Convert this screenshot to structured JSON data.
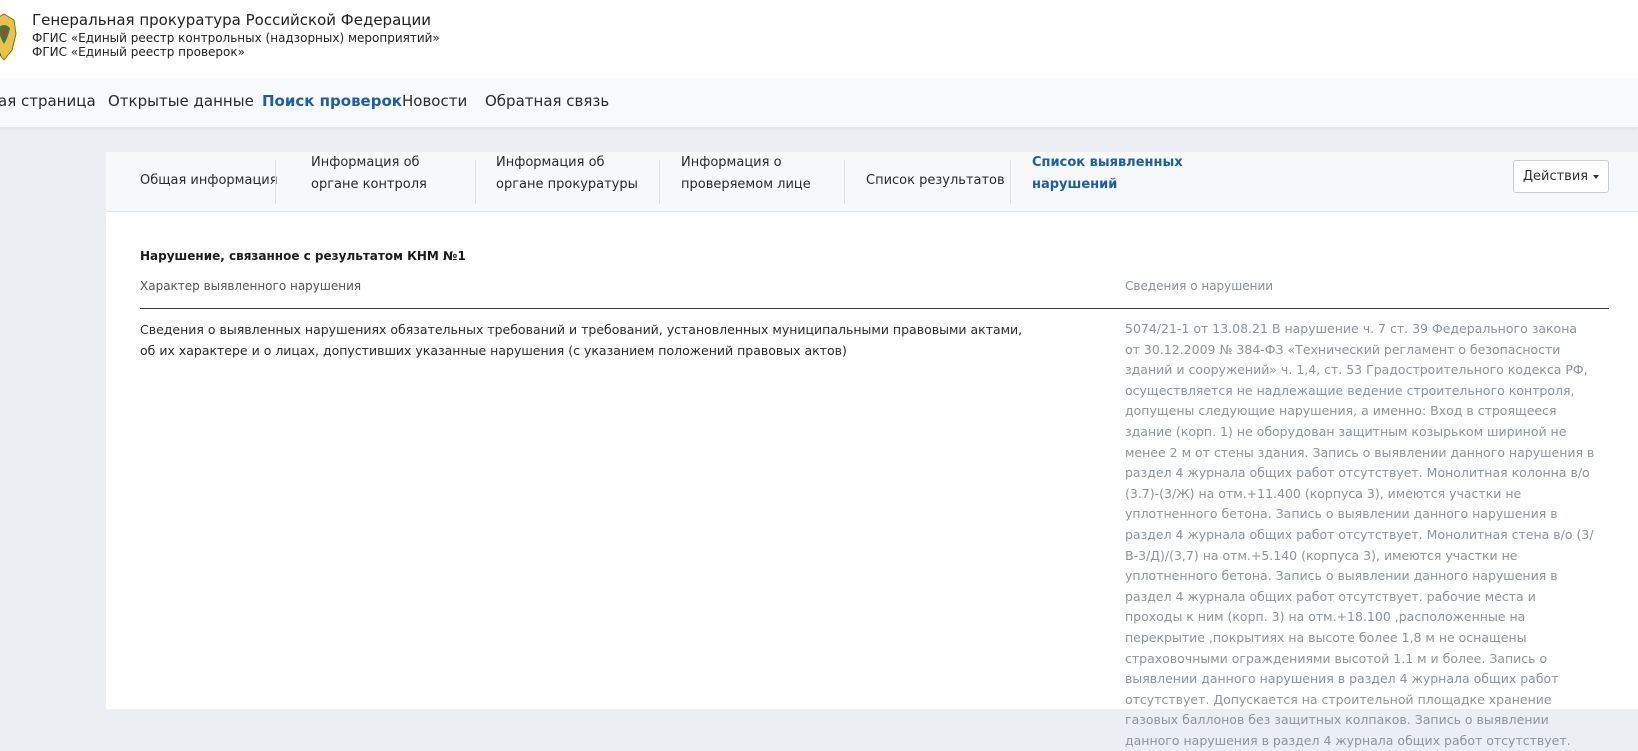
{
  "header": {
    "org_title": "Генеральная прокуратура Российской Федерации",
    "subtitle_1": "ФГИС «Единый реестр контрольных (надзорных) мероприятий»",
    "subtitle_2": "ФГИС «Единый реестр проверок»",
    "emblem_icon": "coat-of-arms-icon"
  },
  "nav": {
    "items": [
      {
        "label": "ая страница",
        "active": false
      },
      {
        "label": "Открытые данные",
        "active": false
      },
      {
        "label": "Поиск проверок",
        "active": true
      },
      {
        "label": "Новости",
        "active": false
      },
      {
        "label": "Обратная связь",
        "active": false
      }
    ]
  },
  "tabs": {
    "items": [
      {
        "line1": "Общая информация",
        "line2": ""
      },
      {
        "line1": "Информация об",
        "line2": "органе контроля"
      },
      {
        "line1": "Информация об",
        "line2": "органе прокуратуры"
      },
      {
        "line1": "Информация о",
        "line2": "проверяемом лице"
      },
      {
        "line1": "Список результатов",
        "line2": ""
      },
      {
        "line1": "Список выявленных",
        "line2": "нарушений"
      }
    ],
    "active_index": 5,
    "actions_label": "Действия"
  },
  "content": {
    "section_title": "Нарушение, связанное с результатом КНМ №1",
    "col_left_header": "Характер выявленного нарушения",
    "col_right_header": "Сведения о нарушении",
    "left_text": "Сведения о выявленных нарушениях обязательных требований и требований, установленных муниципальными правовыми актами, об их характере и о лицах, допустивших указанные нарушения (с указанием положений правовых актов)",
    "right_text": "5074/21-1 от 13.08.21 В нарушение ч. 7 ст. 39 Федерального закона от 30.12.2009 № 384-ФЗ «Технический регламент о безопасности зданий и сооружений» ч. 1,4, ст. 53 Градостроительного кодекса РФ, осуществляется не надлежащие ведение строительного контроля, допущены следующие нарушения, а именно: Вход в строящееся здание (корп. 1) не оборудован защитным козырьком шириной не менее 2 м от стены здания. Запись о выявлении данного нарушения в раздел 4 журнала общих работ отсутствует. Монолитная колонна в/о (3.7)-(3/Ж) на отм.+11.400 (корпуса 3), имеются участки не уплотненного бетона. Запись о выявлении данного нарушения в раздел 4 журнала общих работ отсутствует. Монолитная стена в/о (3/В-3/Д)/(3,7) на отм.+5.140 (корпуса 3), имеются участки не уплотненного бетона. Запись о выявлении данного нарушения в раздел 4 журнала общих работ отсутствует. рабочие места и проходы к ним (корп. 3) на отм.+18.100 ,расположенные на перекрытие ,покрытиях на высоте более 1,8 м не оснащены страховочными ограждениями высотой 1.1 м и более. Запись о выявлении данного нарушения в раздел 4 журнала общих работ отсутствует. Допускается на строительной площадке хранение газовых баллонов без защитных колпаков. Запись о выявлении данного нарушения в раздел 4 журнала общих работ отсутствует."
  },
  "colors": {
    "accent": "#1a5fa8",
    "muted_text": "#8e949b",
    "page_bg": "#ebeef2"
  }
}
